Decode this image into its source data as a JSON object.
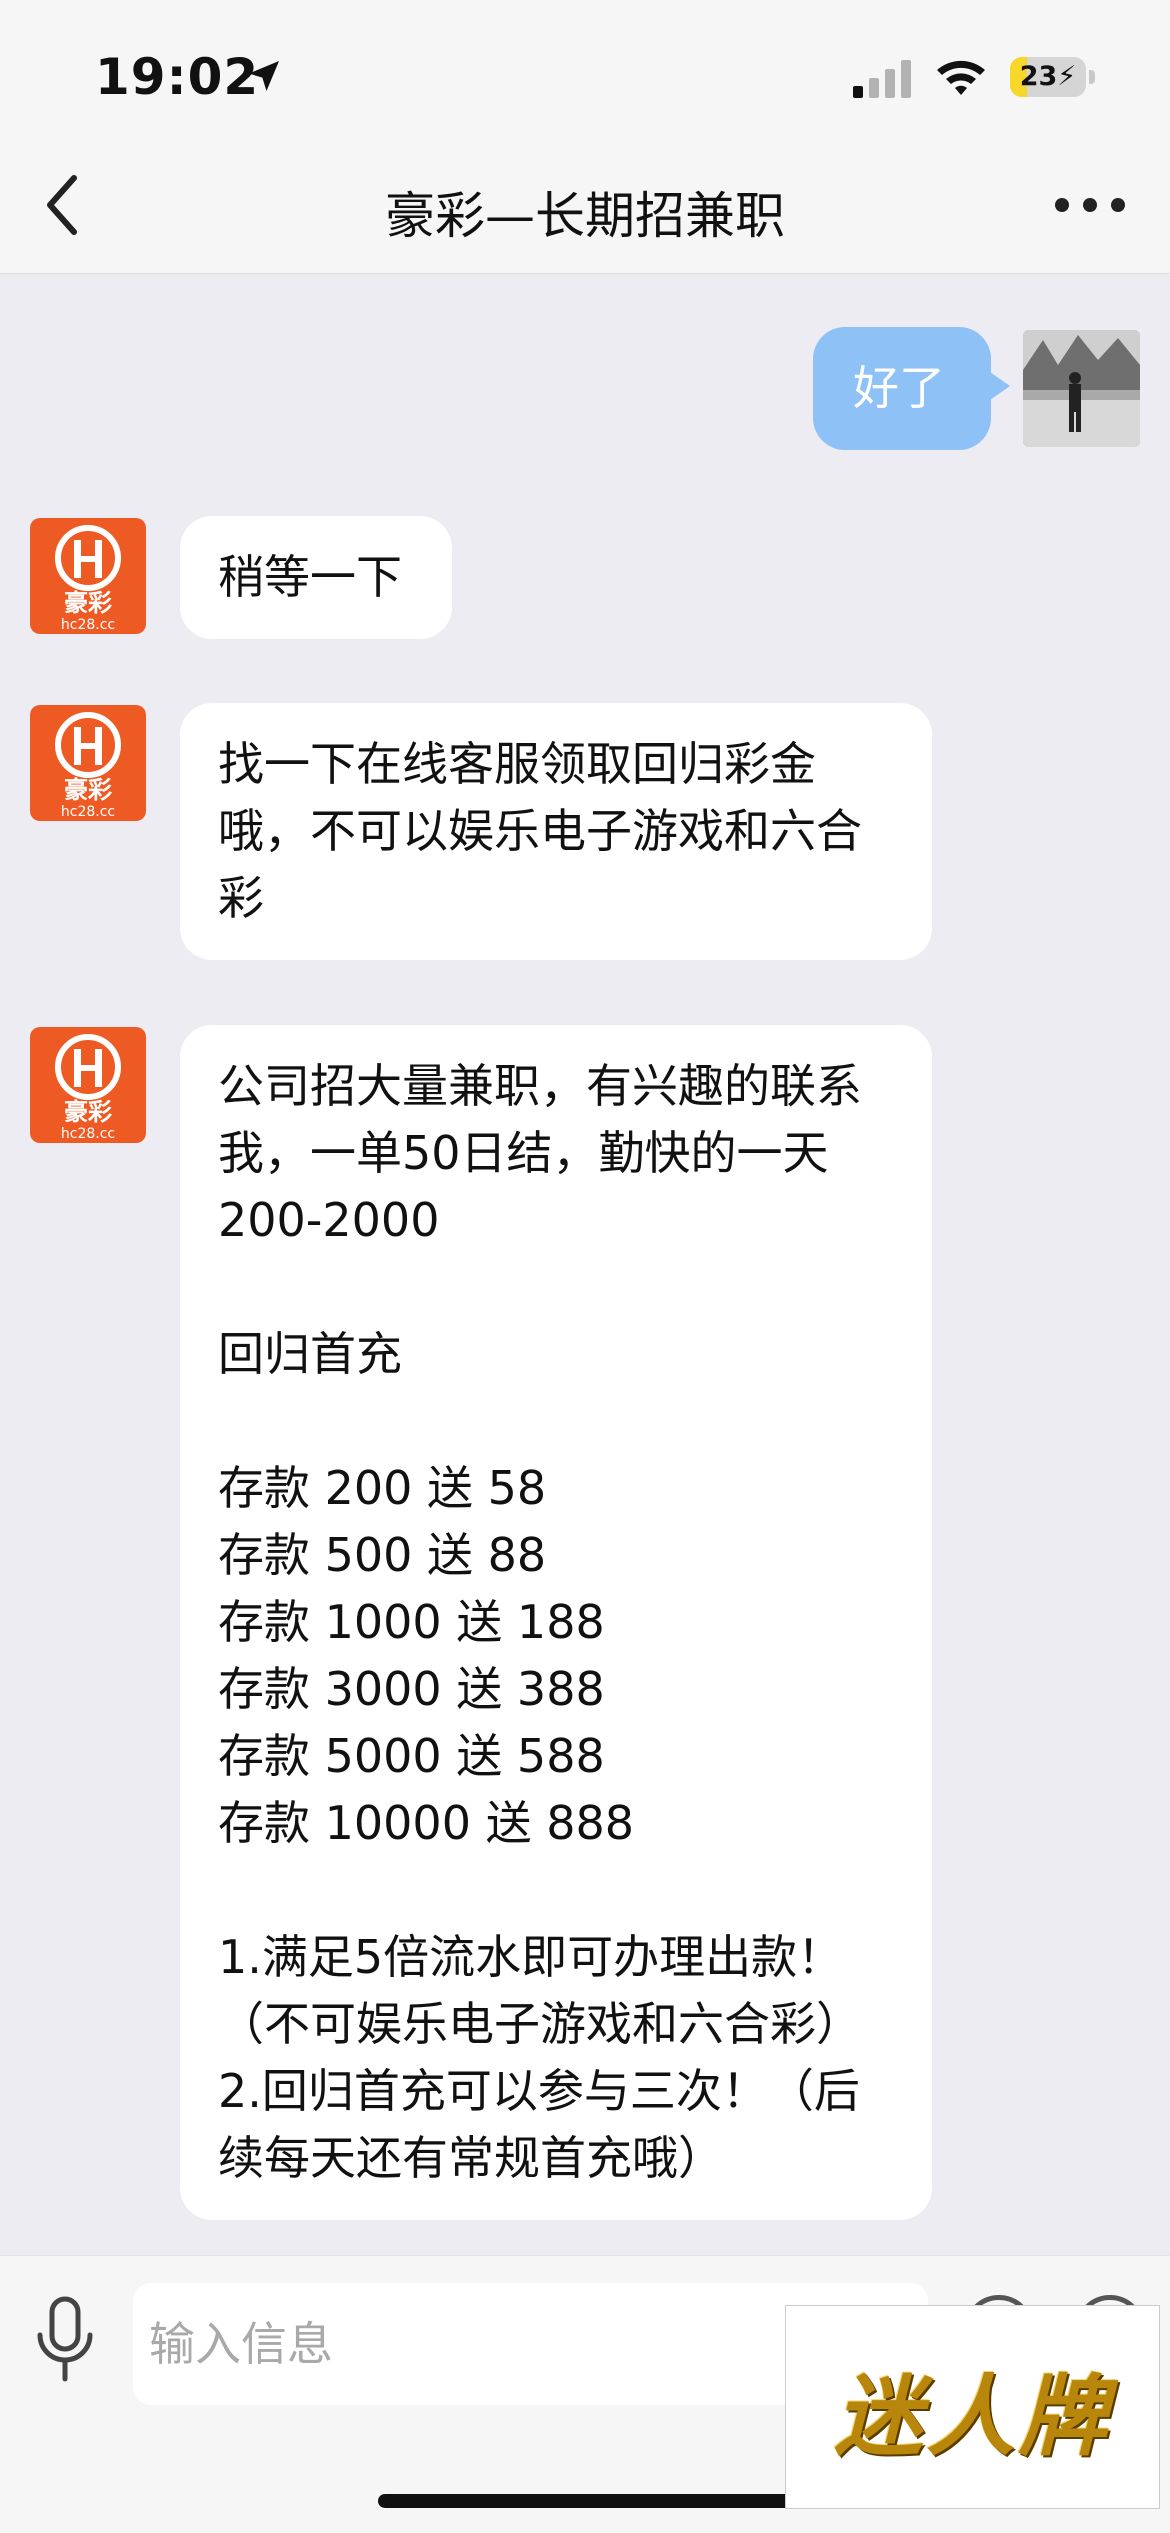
{
  "status_bar": {
    "time": "19:02",
    "battery_percent": "23",
    "battery_level": 0.23,
    "icons": [
      "location-arrow-icon",
      "signal-icon",
      "wifi-icon",
      "battery-charging-icon"
    ]
  },
  "nav": {
    "title": "豪彩—长期招兼职",
    "back_icon": "chevron-left-icon",
    "more_icon": "more-dots-icon"
  },
  "brand_avatar": {
    "logo_char": "豪彩",
    "domain_text": "hc28.cc"
  },
  "messages": [
    {
      "side": "right",
      "text": "好了"
    },
    {
      "side": "left",
      "text": "稍等一下"
    },
    {
      "side": "left",
      "text": "找一下在线客服领取回归彩金\n哦，不可以娱乐电子游戏和六合\n彩"
    },
    {
      "side": "left",
      "text": "公司招大量兼职，有兴趣的联系\n我，一单50日结，勤快的一天\n200-2000\n\n回归首充\n\n存款 200 送 58\n存款 500 送 88\n存款 1000 送 188\n存款 3000 送 388\n存款 5000 送 588\n存款 10000 送 888\n\n1.满足5倍流水即可办理出款！\n（不可娱乐电子游戏和六合彩）\n2.回归首充可以参与三次！（后\n续每天还有常规首充哦）"
    }
  ],
  "input": {
    "placeholder": "输入信息",
    "value": ""
  },
  "watermark": {
    "text": "迷人牌"
  },
  "colors": {
    "brand_orange": "#ee5a24",
    "sent_bubble": "#8ec1f6",
    "background": "#ececf2"
  }
}
